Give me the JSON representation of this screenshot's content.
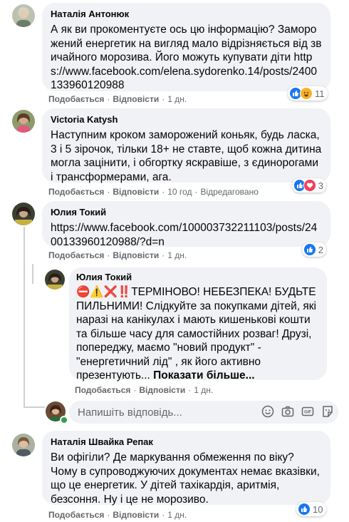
{
  "comments": [
    {
      "author": "Наталія Антонюк",
      "text": "А як ви прокоментуєте ось цю інформацію? Заморожений енергетик на вигляд мало відрізняється від звичайного морозива. Його можуть купувати діти https://www.facebook.com/elena.sydorenko.14/posts/2400133960120988",
      "like": "Подобається",
      "reply": "Відповісти",
      "time": "1 дн.",
      "reaction_count": "11"
    },
    {
      "author": "Victoria Katysh",
      "text": "Наступним кроком заморожений коньяк, будь ласка, 3 і 5 зірочок, тільки 18+ не ставте, щоб кожна дитина могла зацінити, і обгортку яскравіше, з єдинорогами і трансформерами, ага.",
      "like": "Подобається",
      "reply": "Відповісти",
      "time": "10 год",
      "edited": "Відредаговано",
      "reaction_count": "3"
    },
    {
      "author": "Юлия Токий",
      "text": "https://www.facebook.com/100003732211103/posts/2400133960120988/?d=n",
      "like": "Подобається",
      "reply": "Відповісти",
      "time": "1 дн.",
      "reaction_count": "2"
    },
    {
      "author": "Юлия Токий",
      "emoji": "⛔⚠️❌‼️",
      "text": "ТЕРМІНОВО! НЕБЕЗПЕКА! БУДЬТЕ ПИЛЬНИМИ! Слідкуйте за покупками дітей, які наразі на канікулах і мають кишенькові кошти та більше часу для самостійних розваг! Друзі, попереджу, маємо \"новий продукт\" - \"енергетичний лід\" , як його активно презентують...",
      "more": "Показати більше...",
      "like": "Подобається",
      "reply": "Відповісти",
      "time": "1 дн."
    },
    {
      "author": "Наталія Швайка Репак",
      "text": "Ви офігіли? Де маркування обмеження по віку? Чому в супроводжуючих документах немає вказівки, що це енергетик. У дітей тахікардія, аритмія, безсоння. Ну і це не морозиво.",
      "like": "Подобається",
      "reply": "Відповісти",
      "time": "1 дн.",
      "reaction_count": "10"
    }
  ],
  "composer": {
    "placeholder": "Напишіть відповідь..."
  },
  "icons": {
    "like": "like-icon",
    "haha": "haha-icon",
    "love": "love-icon",
    "emoji": "emoji-icon",
    "camera": "camera-icon",
    "gif": "gif-icon",
    "sticker": "sticker-icon"
  },
  "colors": {
    "like_blue": "#1877f2",
    "love_red": "#f33e58",
    "haha_yellow": "#f7b125",
    "bubble": "#f0f2f5",
    "meta_text": "#65676b"
  }
}
